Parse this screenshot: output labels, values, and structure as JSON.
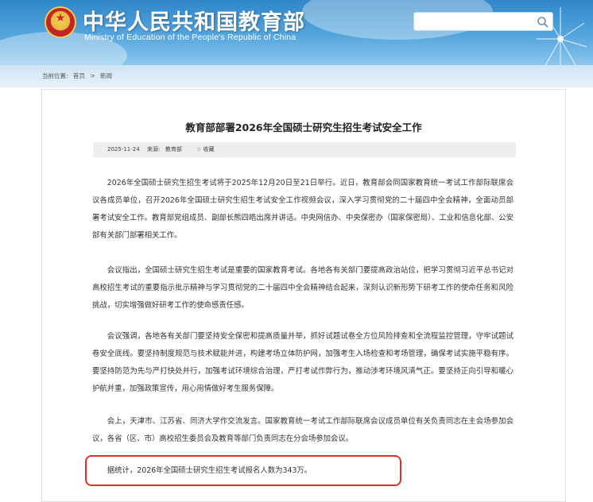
{
  "header": {
    "site_title": "中华人民共和国教育部",
    "site_subtitle": "Ministry of Education of the People's Republic of China",
    "search_placeholder": "",
    "colors": {
      "bg_top": "#2f86c9",
      "bg_bottom": "#8cc6ec",
      "title": "#ffffff"
    }
  },
  "breadcrumb": {
    "current_label": "当前位置:",
    "items": [
      "首页",
      "新闻"
    ]
  },
  "article": {
    "title": "教育部部署2026年全国硕士研究生招生考试安全工作",
    "date": "2025-11-24",
    "source_label": "来源:",
    "source": "教育部",
    "favorite_label": "收藏",
    "paragraphs": [
      "2026年全国硕士研究生招生考试将于2025年12月20日至21日举行。近日，教育部会同国家教育统一考试工作部际联席会议各成员单位，召开2026年全国硕士研究生招生考试安全工作视频会议，深入学习贯彻党的二十届四中全会精神，全面动员部署考试安全工作。教育部党组成员、副部长熊四皓出席并讲话。中央网信办、中央保密办（国家保密局）、工业和信息化部、公安部有关部门部署相关工作。",
      "会议指出，全国硕士研究生招生考试是重要的国家教育考试。各地各有关部门要提高政治站位，把学习贯彻习近平总书记对高校招生考试的重要指示批示精神与学习贯彻党的二十届四中全会精神结合起来，深刻认识新形势下研考工作的使命任务和风险挑战，切实增强做好研考工作的使命感责任感。",
      "会议强调，各地各有关部门要坚持安全保密和提高质量并举，抓好试题试卷全方位风险排查和全流程监控管理，守牢试题试卷安全底线。要坚持制度规范与技术赋能并进，构建考场立体防护网，加强考生入场检查和考场管理，确保考试实施平稳有序。要坚持防范为先与严打快处并行，加强考试环境综合治理，严打考试作弊行为，推动涉考环境风清气正。要坚持正向引导和暖心护航并重，加强政策宣传，用心用情做好考生服务保障。",
      "会上，天津市、江苏省、同济大学作交流发言。国家教育统一考试工作部际联席会议成员单位有关负责同志在主会场参加会议，各省（区、市）高校招生委员会及教育等部门负责同志在分会场参加会议。",
      "据统计，2026年全国硕士研究生招生考试报名人数为343万。"
    ],
    "highlight_color": "#e0312c"
  }
}
